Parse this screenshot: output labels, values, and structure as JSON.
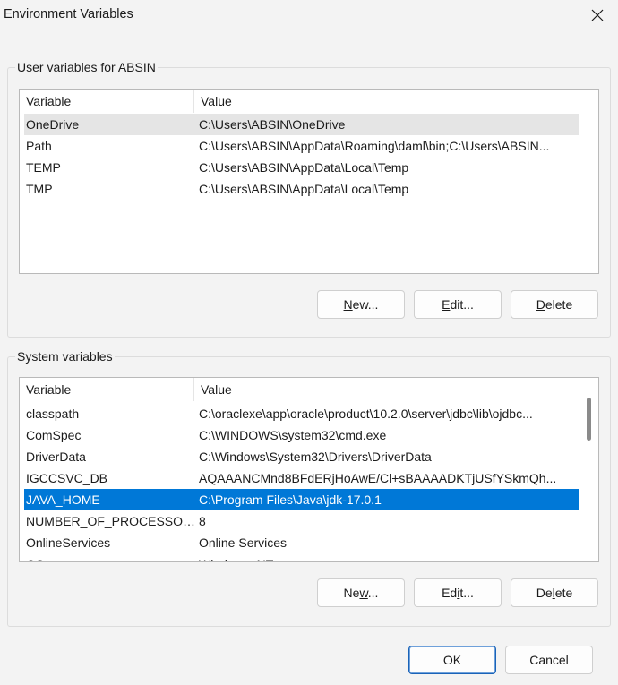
{
  "window": {
    "title": "Environment Variables",
    "close_glyph": "✕"
  },
  "user_group": {
    "label": "User variables for ABSIN",
    "columns": [
      "Variable",
      "Value"
    ],
    "rows": [
      {
        "variable": "OneDrive",
        "value": "C:\\Users\\ABSIN\\OneDrive"
      },
      {
        "variable": "Path",
        "value": "C:\\Users\\ABSIN\\AppData\\Roaming\\daml\\bin;C:\\Users\\ABSIN..."
      },
      {
        "variable": "TEMP",
        "value": "C:\\Users\\ABSIN\\AppData\\Local\\Temp"
      },
      {
        "variable": "TMP",
        "value": "C:\\Users\\ABSIN\\AppData\\Local\\Temp"
      }
    ],
    "buttons": {
      "new": {
        "pre": "",
        "accel": "N",
        "post": "ew..."
      },
      "edit": {
        "pre": "",
        "accel": "E",
        "post": "dit..."
      },
      "delete": {
        "pre": "",
        "accel": "D",
        "post": "elete"
      }
    }
  },
  "system_group": {
    "label": "System variables",
    "columns": [
      "Variable",
      "Value"
    ],
    "rows": [
      {
        "variable": "classpath",
        "value": "C:\\oraclexe\\app\\oracle\\product\\10.2.0\\server\\jdbc\\lib\\ojdbc..."
      },
      {
        "variable": "ComSpec",
        "value": "C:\\WINDOWS\\system32\\cmd.exe"
      },
      {
        "variable": "DriverData",
        "value": "C:\\Windows\\System32\\Drivers\\DriverData"
      },
      {
        "variable": "IGCCSVC_DB",
        "value": "AQAAANCMnd8BFdERjHoAwE/Cl+sBAAAADKTjUSfYSkmQh..."
      },
      {
        "variable": "JAVA_HOME",
        "value": "C:\\Program Files\\Java\\jdk-17.0.1"
      },
      {
        "variable": "NUMBER_OF_PROCESSORS",
        "value": "8"
      },
      {
        "variable": "OnlineServices",
        "value": "Online Services"
      },
      {
        "variable": "OS",
        "value": "Windows_NT"
      }
    ],
    "selected_variable": "JAVA_HOME",
    "buttons": {
      "new": {
        "pre": "Ne",
        "accel": "w",
        "post": "..."
      },
      "edit": {
        "pre": "Ed",
        "accel": "i",
        "post": "t..."
      },
      "delete": {
        "pre": "De",
        "accel": "l",
        "post": "ete"
      }
    }
  },
  "footer": {
    "ok_label": "OK",
    "cancel_label": "Cancel"
  },
  "colors": {
    "selection": "#0078d7",
    "hover_row": "#e5e5e5",
    "background": "#f3f3f3"
  }
}
